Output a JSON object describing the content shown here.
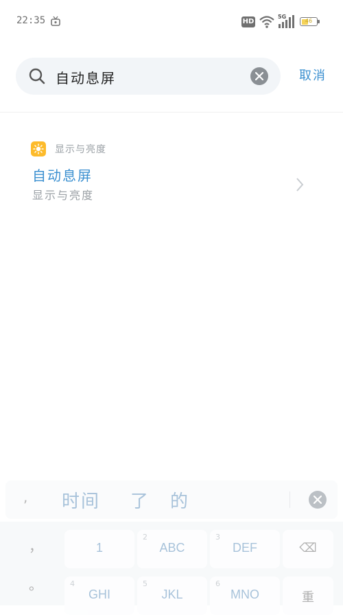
{
  "status_bar": {
    "time": "22:35",
    "hd_label": "HD",
    "network_label": "5G",
    "battery_text": "46",
    "battery_percent": 46,
    "battery_color": "#f5d35a"
  },
  "search": {
    "query": "自动息屏",
    "cancel_label": "取消",
    "accent_color": "#3a8fd0"
  },
  "result": {
    "category_icon": "sun-icon",
    "category_label": "显示与亮度",
    "title": "自动息屏",
    "subtitle": "显示与亮度"
  },
  "ime": {
    "candidates_lead": ",",
    "candidates": [
      "时间",
      "了",
      "的"
    ],
    "left_column": [
      "，",
      "。"
    ],
    "keys": [
      {
        "num": "",
        "label": "1"
      },
      {
        "num": "2",
        "label": "ABC"
      },
      {
        "num": "3",
        "label": "DEF"
      },
      {
        "num": "",
        "label": "⌫"
      },
      {
        "num": "4",
        "label": "GHI"
      },
      {
        "num": "5",
        "label": "JKL"
      },
      {
        "num": "6",
        "label": "MNO"
      },
      {
        "num": "",
        "label": "重"
      }
    ]
  }
}
